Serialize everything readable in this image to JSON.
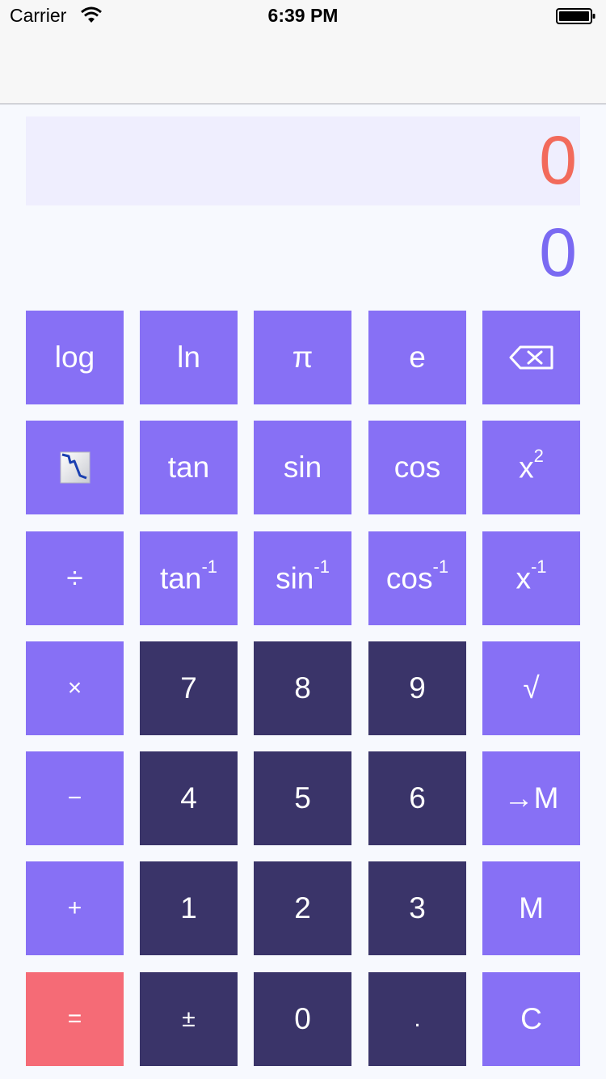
{
  "status_bar": {
    "carrier": "Carrier",
    "time": "6:39 PM"
  },
  "display": {
    "primary_value": "0",
    "secondary_value": "0"
  },
  "keys": {
    "log": "log",
    "ln": "ln",
    "pi": "π",
    "e": "e",
    "tan": "tan",
    "sin": "sin",
    "cos": "cos",
    "x": "x",
    "square_exp": "2",
    "inv_exp": "-1",
    "divide": "÷",
    "tan_base": "tan",
    "sin_base": "sin",
    "cos_base": "cos",
    "x_base": "x",
    "multiply": "×",
    "seven": "7",
    "eight": "8",
    "nine": "9",
    "sqrt": "√",
    "minus": "−",
    "four": "4",
    "five": "5",
    "six": "6",
    "to_memory": "→M",
    "plus": "+",
    "one": "1",
    "two": "2",
    "three": "3",
    "memory": "M",
    "equals": "=",
    "plus_minus": "±",
    "zero": "0",
    "decimal": ".",
    "clear": "C"
  },
  "colors": {
    "function_key": "#8770F5",
    "number_key": "#3A3469",
    "equals_key": "#F56B76",
    "primary_display_text": "#F26A5B",
    "secondary_display_text": "#7A6AF2",
    "primary_display_bg": "#EFEEFE",
    "background": "#F7F9FE"
  },
  "icons": {
    "wifi": "wifi-icon",
    "battery": "battery-icon",
    "graph": "graph-icon",
    "backspace": "backspace-icon"
  }
}
